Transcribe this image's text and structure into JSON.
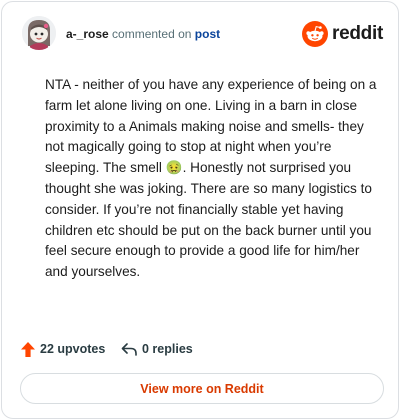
{
  "header": {
    "username": "a-_rose",
    "action_text": "commented on",
    "target_link": "post",
    "brand_name": "reddit",
    "avatar_icon": "snoo-avatar-icon",
    "logo_icon": "reddit-snoo-icon"
  },
  "comment": {
    "text_before_emoji": "NTA - neither of you have any experience of being on a farm let alone living on one. Living in a barn in close proximity to a Animals making noise and smells- they not magically going to stop at night when you’re sleeping. The smell ",
    "emoji": "🤢",
    "text_after_emoji": ". Honestly not surprised you thought she was joking. There are so many logistics to consider. If you’re not financially stable yet having children etc should be put on the back burner until you feel secure enough to provide a good life for him/her and yourselves."
  },
  "actions": {
    "upvotes_label": "22 upvotes",
    "replies_label": "0 replies",
    "upvote_icon": "upvote-arrow-icon",
    "reply_icon": "reply-arrow-icon"
  },
  "footer": {
    "view_more_label": "View more on Reddit"
  },
  "colors": {
    "brand_orange": "#ff4500",
    "link_blue": "#0a449b",
    "button_text": "#d93a00",
    "muted_text": "#576f76"
  }
}
